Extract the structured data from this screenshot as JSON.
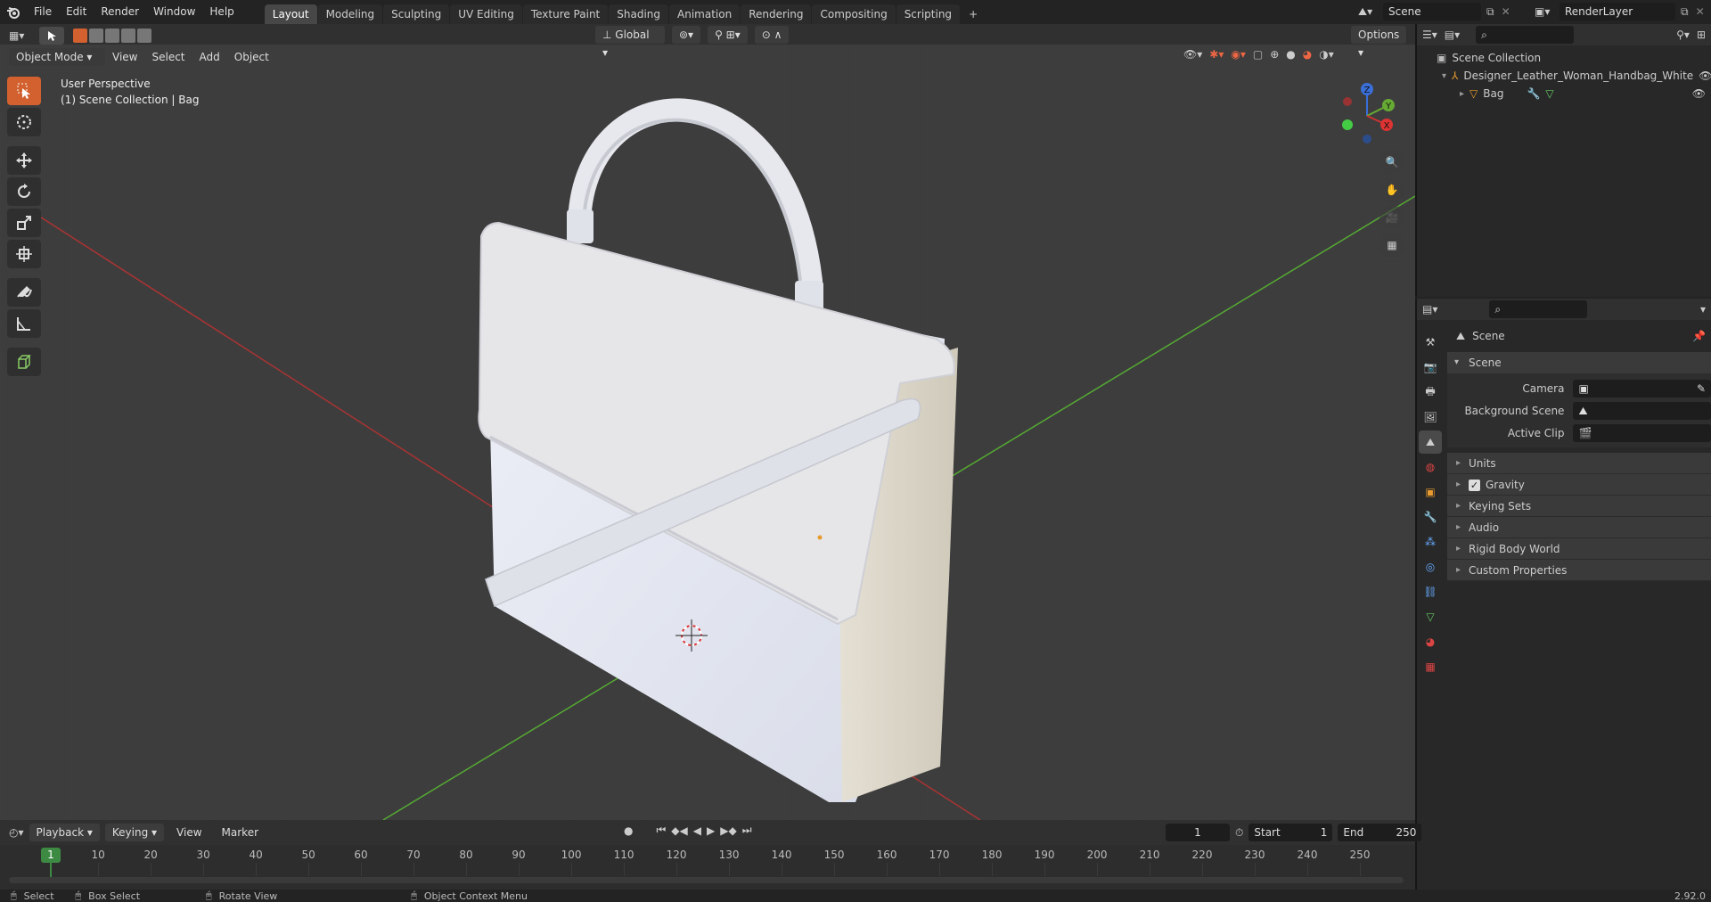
{
  "menu": [
    "File",
    "Edit",
    "Render",
    "Window",
    "Help"
  ],
  "workspaces": [
    "Layout",
    "Modeling",
    "Sculpting",
    "UV Editing",
    "Texture Paint",
    "Shading",
    "Animation",
    "Rendering",
    "Compositing",
    "Scripting"
  ],
  "active_workspace": "Layout",
  "add_workspace": "+",
  "scene_name": "Scene",
  "view_layer": "RenderLayer",
  "header": {
    "mode": "Object Mode",
    "menus": [
      "View",
      "Select",
      "Add",
      "Object"
    ],
    "transform_orientation": "Global",
    "options": "Options"
  },
  "viewport": {
    "perspective": "User Perspective",
    "collection_info": "(1) Scene Collection | Bag"
  },
  "gizmo": {
    "z": "Z",
    "y": "Y",
    "x": "X"
  },
  "outliner": {
    "root": "Scene Collection",
    "items": [
      {
        "name": "Designer_Leather_Woman_Handbag_White"
      },
      {
        "name": "Bag"
      }
    ]
  },
  "properties": {
    "context_title": "Scene",
    "panel_title": "Scene",
    "fields": [
      {
        "label": "Camera"
      },
      {
        "label": "Background Scene"
      },
      {
        "label": "Active Clip"
      }
    ],
    "subpanels": [
      "Units",
      "Gravity",
      "Keying Sets",
      "Audio",
      "Rigid Body World",
      "Custom Properties"
    ]
  },
  "timeline": {
    "menus": [
      "Playback",
      "Keying",
      "View",
      "Marker"
    ],
    "current_frame": "1",
    "start_label": "Start",
    "start": "1",
    "end_label": "End",
    "end": "250",
    "ticks": [
      "1",
      "10",
      "20",
      "30",
      "40",
      "50",
      "60",
      "70",
      "80",
      "90",
      "100",
      "110",
      "120",
      "130",
      "140",
      "150",
      "160",
      "170",
      "180",
      "190",
      "200",
      "210",
      "220",
      "230",
      "240",
      "250"
    ]
  },
  "status": {
    "select": "Select",
    "box_select": "Box Select",
    "rotate_view": "Rotate View",
    "context_menu": "Object Context Menu",
    "version": "2.92.0"
  }
}
